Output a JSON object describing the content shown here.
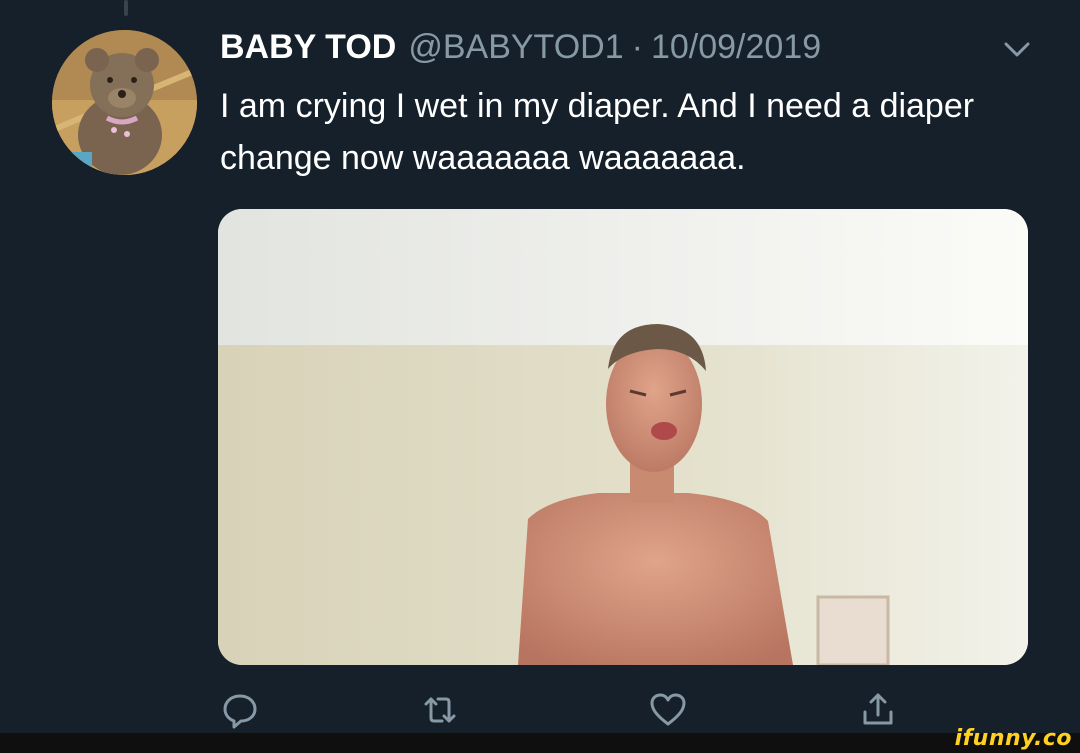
{
  "tweet": {
    "display_name": "BABY TOD",
    "handle": "@BABYTOD1",
    "separator": "·",
    "date": "10/09/2019",
    "text": "I am crying I wet in my diaper. And I need a diaper change now waaaaaaa  waaaaaaa."
  },
  "icons": {
    "menu": "chevron-down-icon",
    "reply": "reply-icon",
    "retweet": "retweet-icon",
    "like": "heart-icon",
    "share": "share-icon"
  },
  "watermark": "ifunny.co",
  "colors": {
    "background": "#15202b",
    "secondary_text": "#8899a6",
    "primary_text": "#ffffff",
    "watermark": "#ffd21f"
  }
}
